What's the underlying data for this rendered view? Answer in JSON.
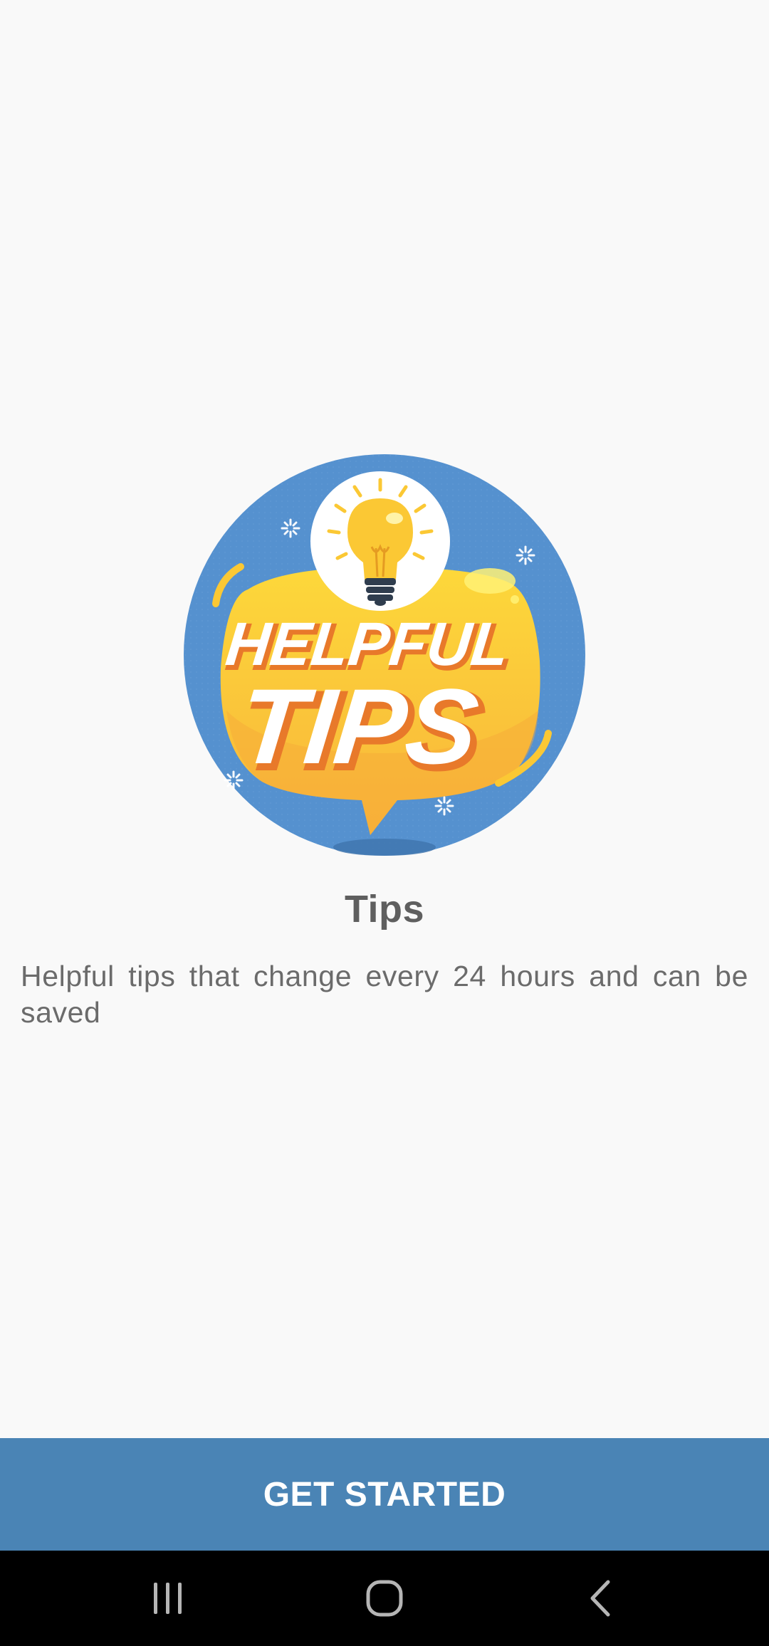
{
  "onboarding": {
    "hero_image": {
      "icon": "helpful-tips-lightbulb-badge",
      "badge_line1": "HELPFUL",
      "badge_line2": "TIPS"
    },
    "title": "Tips",
    "description": "Helpful tips that change every 24 hours and can be saved",
    "cta_label": "GET STARTED"
  },
  "system_nav": {
    "recents_icon": "recents-icon",
    "home_icon": "home-icon",
    "back_icon": "back-icon"
  },
  "colors": {
    "background": "#f9f9f9",
    "button": "#4a84b5",
    "button_text": "#ffffff",
    "badge_blue": "#5591cf",
    "badge_yellow": "#fbc834",
    "text_title": "#5f5f5f",
    "text_body": "#6b6b6b",
    "nav_bar": "#000000"
  }
}
